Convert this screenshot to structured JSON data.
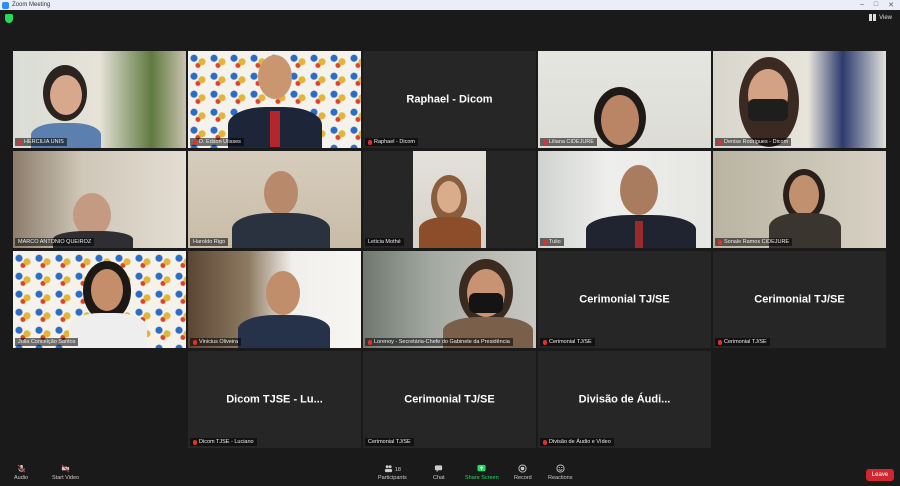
{
  "window": {
    "title": "Zoom Meeting"
  },
  "toolbar_top": {
    "view_label": "View"
  },
  "tiles": [
    {
      "name": "HERCILIA UNIS",
      "muted": true
    },
    {
      "name": "D. Edson Ulisses",
      "muted": true
    },
    {
      "name": "Raphael - Dicom",
      "big": "Raphael - Dicom",
      "muted": true
    },
    {
      "name": "Liliana CIDEJURE",
      "muted": true
    },
    {
      "name": "Denise Rodrigues - Dicom",
      "muted": true,
      "active": true
    },
    {
      "name": "MARCO ANTONIO QUEIROZ",
      "muted": false
    },
    {
      "name": "Haroldo Rigo",
      "muted": false
    },
    {
      "name": "Leticia Mothé",
      "muted": false
    },
    {
      "name": "Tulio",
      "muted": true
    },
    {
      "name": "Sonale Ramos CIDEJURE",
      "muted": true
    },
    {
      "name": "Julia Conceição Santos",
      "muted": false
    },
    {
      "name": "Vinicius Oliveira",
      "muted": true
    },
    {
      "name": "Lorenoy - Secretária-Chefe do Gabinete da Presidência",
      "muted": true
    },
    {
      "name": "Cerimonial TJ/SE",
      "big": "Cerimonial TJ/SE",
      "muted": true
    },
    {
      "name": "Cerimonial TJ/SE",
      "big": "Cerimonial TJ/SE",
      "muted": true
    },
    {
      "name": "Dicom TJSE - Luciano",
      "big": "Dicom TJSE - Lu...",
      "muted": true
    },
    {
      "name": "Cerimonial TJ/SE",
      "big": "Cerimonial TJ/SE",
      "muted": false
    },
    {
      "name": "Divisão de Áudio e Vídeo",
      "big": "Divisão de Áudi...",
      "muted": true
    }
  ],
  "bottom_toolbar": {
    "audio": "Audio",
    "start_video": "Start Video",
    "participants": "Participants",
    "participants_count": "18",
    "chat": "Chat",
    "share_screen": "Share Screen",
    "record": "Record",
    "reactions": "Reactions",
    "leave": "Leave"
  },
  "colors": {
    "accent_active": "#e5ef5b",
    "share_green": "#23d962",
    "leave_red": "#d0262d"
  }
}
